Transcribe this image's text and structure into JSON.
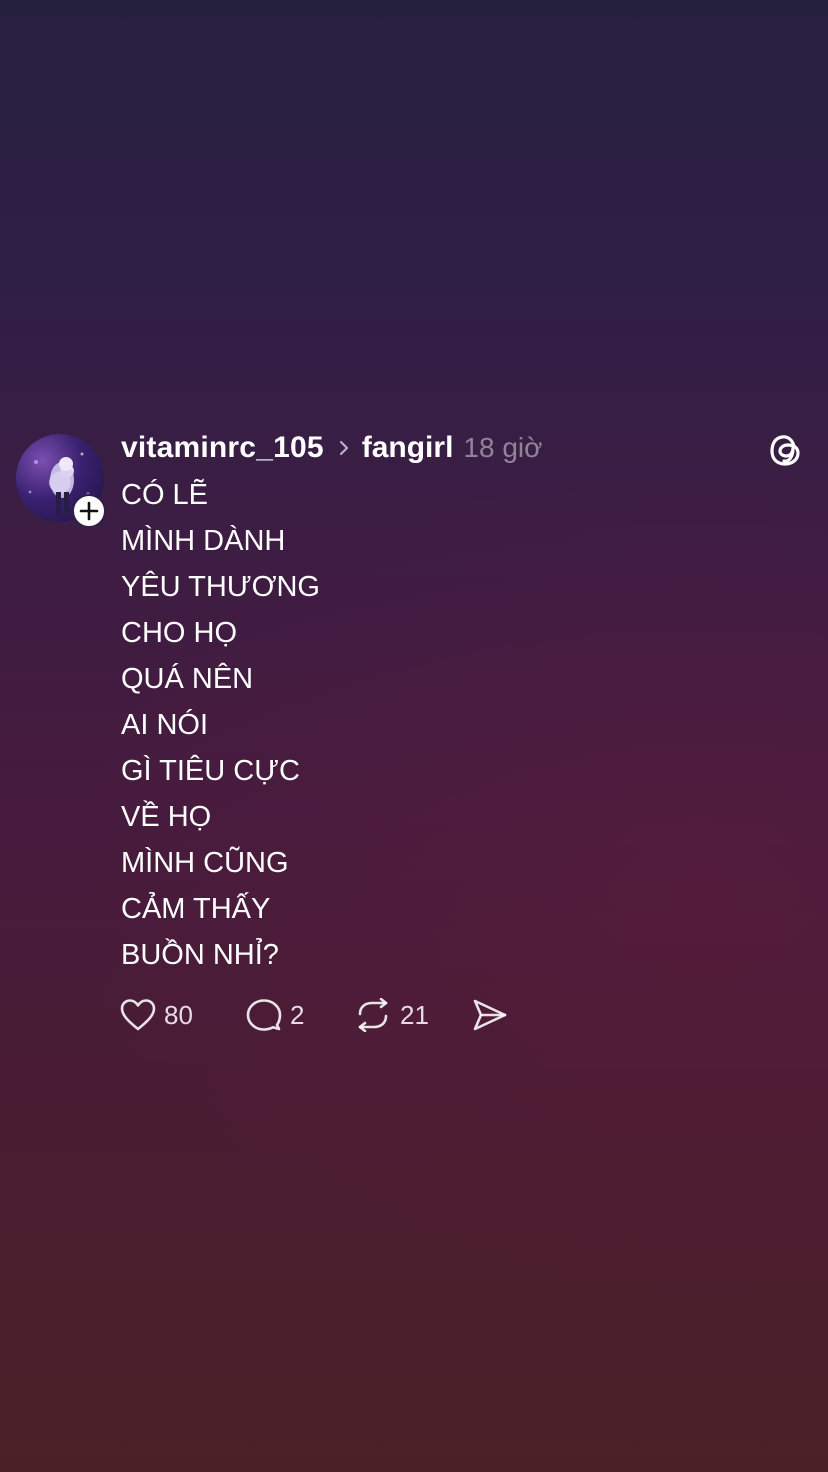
{
  "post": {
    "username": "vitaminrc_105",
    "community": "fangirl",
    "time": "18 giờ",
    "lines": [
      "CÓ LẼ",
      "MÌNH DÀNH",
      "YÊU THƯƠNG",
      "CHO HỌ",
      "QUÁ NÊN",
      "AI NÓI",
      "GÌ TIÊU CỰC",
      "VỀ HỌ",
      "MÌNH CŨNG",
      "CẢM THẤY",
      "BUỒN NHỈ?"
    ],
    "actions": {
      "likes": "80",
      "replies": "2",
      "reposts": "21"
    }
  },
  "icons": {
    "avatar": "avatar-photo",
    "follow": "plus-icon",
    "separator": "chevron-right-icon",
    "brand": "threads-logo-icon",
    "like": "heart-icon",
    "reply": "comment-icon",
    "repost": "repost-icon",
    "share": "send-icon"
  },
  "colors": {
    "background_top": "#26203f",
    "background_bottom": "#4c2126",
    "text": "#ffffff",
    "muted": "#8a7a92"
  }
}
